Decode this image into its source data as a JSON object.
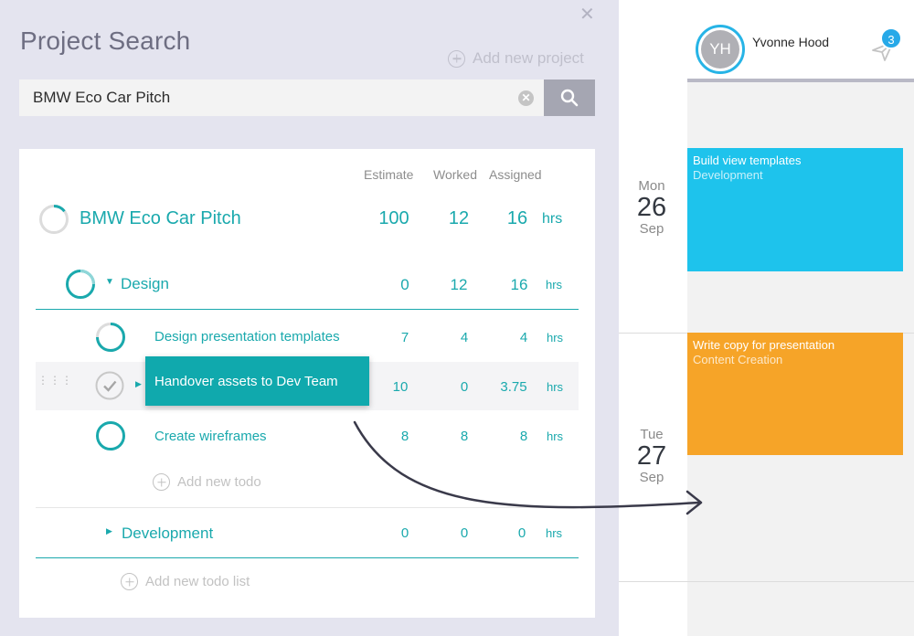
{
  "panel": {
    "title": "Project Search",
    "add_project_label": "Add new project",
    "search_value": "BMW Eco Car Pitch"
  },
  "table": {
    "col_estimate": "Estimate",
    "col_worked": "Worked",
    "col_assigned": "Assigned",
    "project": {
      "name": "BMW Eco Car Pitch",
      "estimate": "100",
      "worked": "12",
      "assigned": "16",
      "unit": "hrs"
    },
    "lists": [
      {
        "name": "Design",
        "estimate": "0",
        "worked": "12",
        "assigned": "16",
        "unit": "hrs",
        "todos": [
          {
            "name": "Design presentation templates",
            "estimate": "7",
            "worked": "4",
            "assigned": "4",
            "unit": "hrs"
          },
          {
            "name": "Handover assets to Dev Team",
            "estimate": "10",
            "worked": "0",
            "assigned": "3.75",
            "unit": "hrs"
          },
          {
            "name": "Create wireframes",
            "estimate": "8",
            "worked": "8",
            "assigned": "8",
            "unit": "hrs"
          }
        ],
        "add_todo_label": "Add new todo"
      },
      {
        "name": "Development",
        "estimate": "0",
        "worked": "0",
        "assigned": "0",
        "unit": "hrs"
      }
    ],
    "add_list_label": "Add new todo list"
  },
  "calendar": {
    "user": {
      "initials": "YH",
      "name": "Yvonne Hood",
      "notifications": "3"
    },
    "days": [
      {
        "dow": "Mon",
        "day": "26",
        "month": "Sep"
      },
      {
        "dow": "Tue",
        "day": "27",
        "month": "Sep"
      }
    ],
    "events": [
      {
        "title": "Build view templates",
        "subtitle": "Development",
        "color": "#1ec3ec"
      },
      {
        "title": "Write copy for presentation",
        "subtitle": "Content Creation",
        "color": "#f6a428"
      }
    ]
  },
  "colors": {
    "teal": "#1aa9ad",
    "panel_bg": "#e4e4ef"
  }
}
